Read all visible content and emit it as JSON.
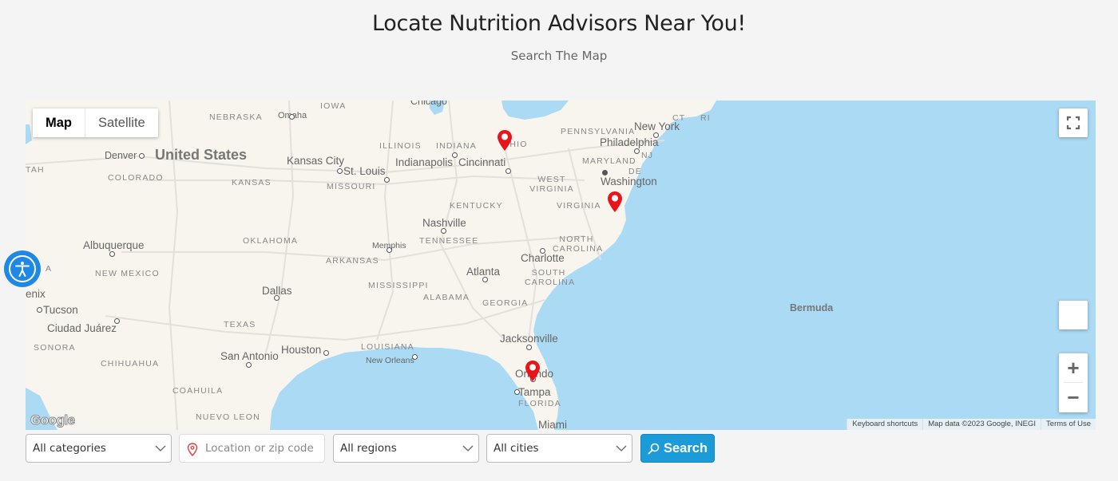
{
  "header": {
    "title": "Locate Nutrition Advisors Near You!",
    "subtitle": "Search The Map"
  },
  "map": {
    "map_type_control": {
      "map_label": "Map",
      "satellite_label": "Satellite",
      "active": "Map"
    },
    "fullscreen_icon": "fullscreen-icon",
    "zoom_in_label": "+",
    "zoom_out_label": "−",
    "google_logo": "Google",
    "attribution": {
      "keyboard_shortcuts": "Keyboard shortcuts",
      "map_data": "Map data ©2023 Google, INEGI",
      "terms": "Terms of Use"
    },
    "country_labels": [
      "United States"
    ],
    "state_labels": [
      "IOWA",
      "NEBRASKA",
      "COLORADO",
      "KANSAS",
      "MISSOURI",
      "ILLINOIS",
      "INDIANA",
      "OHIO",
      "PENNSYLVANIA",
      "MARYLAND",
      "DE",
      "NJ",
      "CT",
      "RI",
      "WEST VIRGINIA",
      "VIRGINIA",
      "KENTUCKY",
      "TENNESSEE",
      "NORTH CAROLINA",
      "SOUTH CAROLINA",
      "GEORGIA",
      "ALABAMA",
      "MISSISSIPPI",
      "ARKANSAS",
      "OKLAHOMA",
      "TEXAS",
      "LOUISIANA",
      "FLORIDA",
      "NEW MEXICO",
      "SONORA",
      "CHIHUAHUA",
      "COAHUILA",
      "NUEVO LEON",
      "TAH",
      "A"
    ],
    "city_labels": [
      "Chicago",
      "Omaha",
      "Denver",
      "Kansas City",
      "St. Louis",
      "Indianapolis",
      "Cincinnati",
      "New York",
      "Philadelphia",
      "Washington",
      "Nashville",
      "Memphis",
      "Charlotte",
      "Atlanta",
      "Albuquerque",
      "Dallas",
      "Houston",
      "San Antonio",
      "New Orleans",
      "Jacksonville",
      "Orlando",
      "Tampa",
      "Miami",
      "Tucson",
      "Ciudad Juárez",
      "enix",
      "Bermuda"
    ],
    "markers": [
      {
        "name": "Ohio advisor",
        "color": "#e8141b"
      },
      {
        "name": "Virginia advisor",
        "color": "#e8141b"
      },
      {
        "name": "Orlando advisor",
        "color": "#e8141b"
      }
    ]
  },
  "accessibility_button": {
    "icon": "accessibility-icon",
    "color": "#1e88e5"
  },
  "filters": {
    "category": {
      "value": "All categories"
    },
    "location": {
      "value": "",
      "placeholder": "Location or zip code"
    },
    "region": {
      "value": "All regions"
    },
    "city": {
      "value": "All cities"
    },
    "search_label": "Search",
    "search_color": "#1b9bd7"
  }
}
